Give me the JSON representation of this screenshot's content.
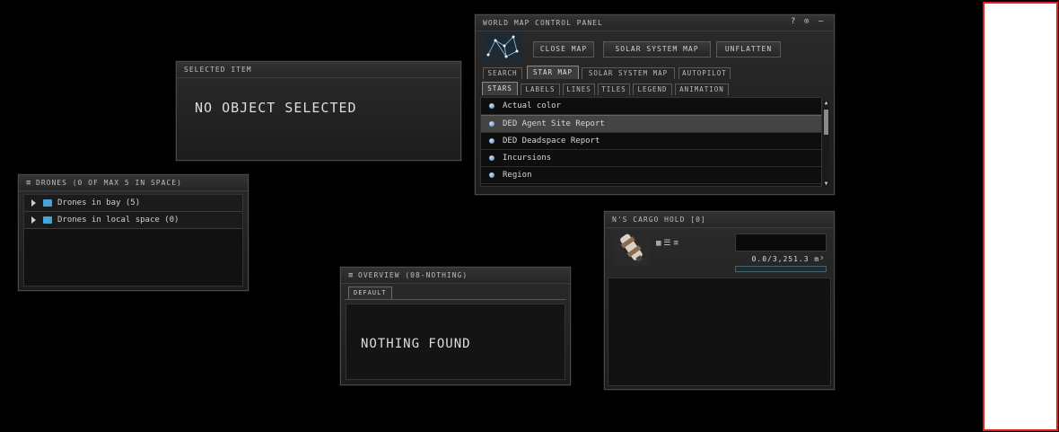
{
  "selected_item": {
    "title": "SELECTED ITEM",
    "message": "NO OBJECT SELECTED"
  },
  "drones": {
    "title": "DRONES (0 OF MAX 5 IN SPACE)",
    "rows": [
      {
        "label": "Drones in bay (5)"
      },
      {
        "label": "Drones in local space (0)"
      }
    ]
  },
  "overview": {
    "title": "OVERVIEW (08-NOTHING)",
    "tab": "DEFAULT",
    "message": "NOTHING FOUND"
  },
  "world_map": {
    "title": "WORLD MAP CONTROL PANEL",
    "window_controls": {
      "help": "?",
      "settings": "⊙",
      "minimize": "–"
    },
    "buttons": {
      "close_map": "CLOSE MAP",
      "solar_system_map": "SOLAR SYSTEM MAP",
      "unflatten": "UNFLATTEN"
    },
    "tabs": [
      "SEARCH",
      "STAR MAP",
      "SOLAR SYSTEM MAP",
      "AUTOPILOT"
    ],
    "subtabs": [
      "STARS",
      "LABELS",
      "LINES",
      "TILES",
      "LEGEND",
      "ANIMATION"
    ],
    "list": [
      {
        "label": "Actual color",
        "selected": false
      },
      {
        "label": "DED Agent Site Report",
        "selected": true
      },
      {
        "label": "DED Deadspace Report",
        "selected": false
      },
      {
        "label": "Incursions",
        "selected": false
      },
      {
        "label": "Region",
        "selected": false
      }
    ]
  },
  "cargo": {
    "title": "N'S CARGO HOLD [0]",
    "capacity": "0.0/3,251.3 m³",
    "capacity_fraction": 0.0,
    "view_icons": [
      "grid-view-icon",
      "list-view-icon",
      "details-view-icon"
    ]
  },
  "colors": {
    "accent_red": "#e02020",
    "radio_blue": "#4a77b8",
    "folder_blue": "#4aa3d8"
  }
}
